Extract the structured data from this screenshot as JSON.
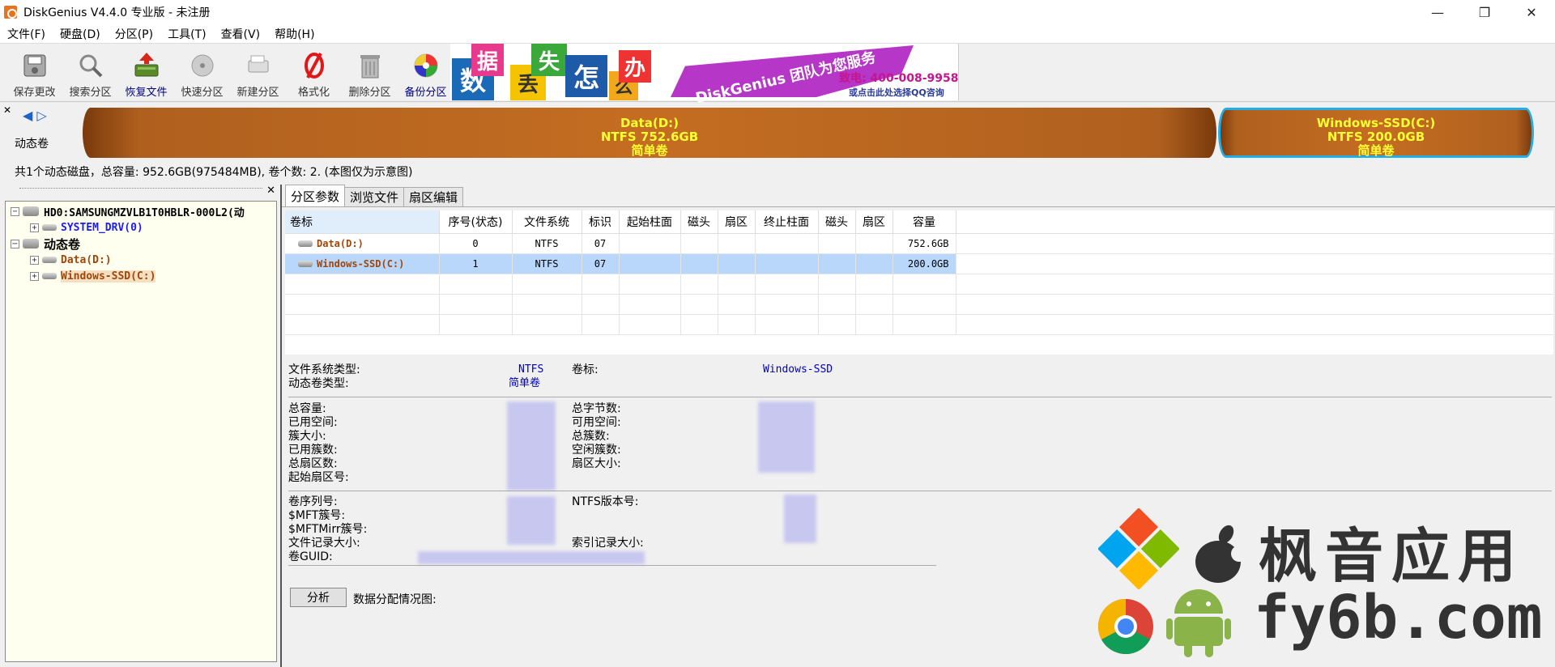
{
  "window": {
    "title": "DiskGenius V4.4.0 专业版 - 未注册",
    "min": "—",
    "max": "❐",
    "close": "✕"
  },
  "menu": [
    "文件(F)",
    "硬盘(D)",
    "分区(P)",
    "工具(T)",
    "查看(V)",
    "帮助(H)"
  ],
  "toolbar": [
    {
      "label": "保存更改",
      "icon": "save-icon"
    },
    {
      "label": "搜索分区",
      "icon": "search-icon"
    },
    {
      "label": "恢复文件",
      "icon": "recover-icon"
    },
    {
      "label": "快速分区",
      "icon": "quick-partition-icon"
    },
    {
      "label": "新建分区",
      "icon": "new-partition-icon"
    },
    {
      "label": "格式化",
      "icon": "format-icon"
    },
    {
      "label": "删除分区",
      "icon": "trash-icon"
    },
    {
      "label": "备份分区",
      "icon": "backup-icon"
    }
  ],
  "banner": {
    "chars": [
      "数",
      "据",
      "丢",
      "失",
      "怎",
      "么",
      "办"
    ],
    "ribbon": "DiskGenius 团队为您服务",
    "phone": "致电: 400-008-9958",
    "qq": "或点击此处选择QQ咨询"
  },
  "diskmap": {
    "label": "动态卷",
    "partitions": [
      {
        "name": "Data(D:)",
        "fs": "NTFS 752.6GB",
        "type": "简单卷"
      },
      {
        "name": "Windows-SSD(C:)",
        "fs": "NTFS 200.0GB",
        "type": "简单卷"
      }
    ],
    "info": "共1个动态磁盘，总容量: 952.6GB(975484MB), 卷个数: 2. (本图仅为示意图)"
  },
  "tree": {
    "hd": "HD0:SAMSUNGMZVLB1T0HBLR-000L2(动",
    "system": "SYSTEM_DRV(0)",
    "dynamic": "动态卷",
    "data": "Data(D:)",
    "windows": "Windows-SSD(C:)"
  },
  "tabs": [
    "分区参数",
    "浏览文件",
    "扇区编辑"
  ],
  "table": {
    "headers": [
      "卷标",
      "序号(状态)",
      "文件系统",
      "标识",
      "起始柱面",
      "磁头",
      "扇区",
      "终止柱面",
      "磁头",
      "扇区",
      "容量"
    ],
    "rows": [
      [
        "Data(D:)",
        "0",
        "NTFS",
        "07",
        "",
        "",
        "",
        "",
        "",
        "",
        "752.6GB"
      ],
      [
        "Windows-SSD(C:)",
        "1",
        "NTFS",
        "07",
        "",
        "",
        "",
        "",
        "",
        "",
        "200.0GB"
      ]
    ]
  },
  "details": {
    "fs_type_label": "文件系统类型:",
    "fs_type": "NTFS",
    "vol_type_label": "动态卷类型:",
    "vol_type": "简单卷",
    "vol_label_label": "卷标:",
    "vol_label": "Windows-SSD",
    "left_labels": [
      "总容量:",
      "已用空间:",
      "簇大小:",
      "已用簇数:",
      "总扇区数:",
      "起始扇区号:"
    ],
    "right_labels": [
      "总字节数:",
      "可用空间:",
      "总簇数:",
      "空闲簇数:",
      "扇区大小:"
    ],
    "left2_labels": [
      "卷序列号:",
      "$MFT簇号:",
      "$MFTMirr簇号:",
      "文件记录大小:",
      "卷GUID:"
    ],
    "ntfs_ver_label": "NTFS版本号:",
    "index_size_label": "索引记录大小:",
    "analyze": "分析",
    "alloc_label": "数据分配情况图:"
  },
  "watermark": {
    "cn": "枫音应用",
    "url": "fy6b.com"
  }
}
